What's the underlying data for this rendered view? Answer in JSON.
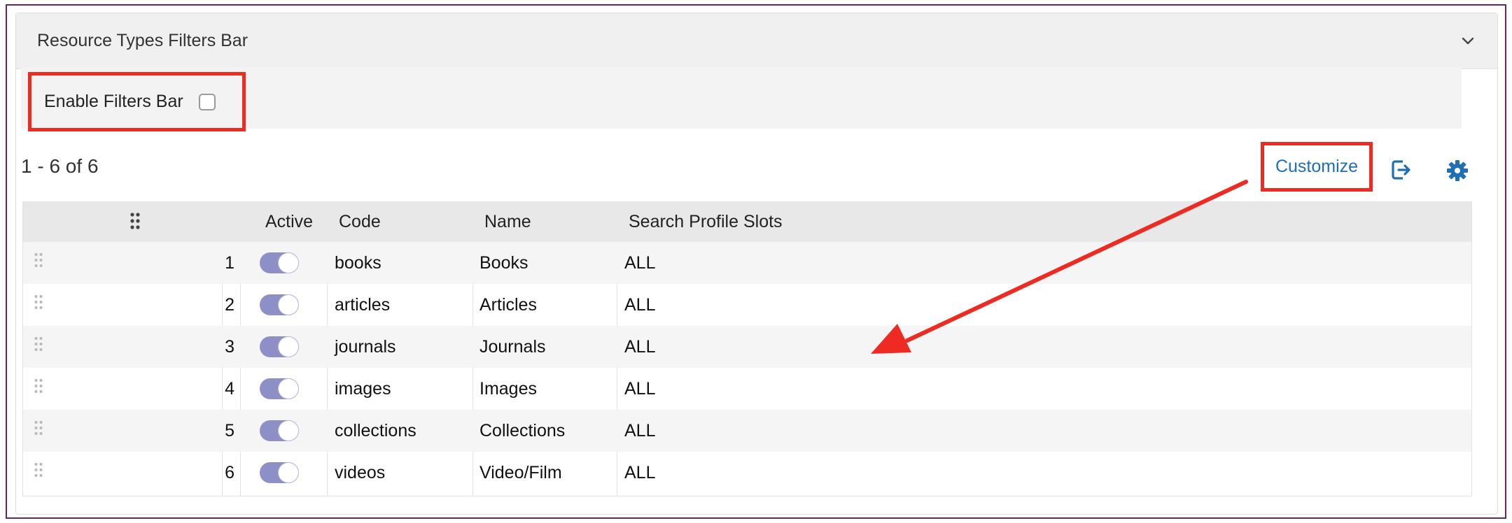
{
  "panel": {
    "title": "Resource Types Filters Bar"
  },
  "filters": {
    "enable_label": "Enable Filters Bar",
    "enabled": false
  },
  "list": {
    "count_label": "1 - 6 of 6"
  },
  "toolbar": {
    "customize_label": "Customize"
  },
  "table": {
    "columns": [
      "Active",
      "Code",
      "Name",
      "Search Profile Slots"
    ],
    "rows": [
      {
        "num": "1",
        "active": true,
        "code": "books",
        "name": "Books",
        "slots": "ALL"
      },
      {
        "num": "2",
        "active": true,
        "code": "articles",
        "name": "Articles",
        "slots": "ALL"
      },
      {
        "num": "3",
        "active": true,
        "code": "journals",
        "name": "Journals",
        "slots": "ALL"
      },
      {
        "num": "4",
        "active": true,
        "code": "images",
        "name": "Images",
        "slots": "ALL"
      },
      {
        "num": "5",
        "active": true,
        "code": "collections",
        "name": "Collections",
        "slots": "ALL"
      },
      {
        "num": "6",
        "active": true,
        "code": "videos",
        "name": "Video/Film",
        "slots": "ALL"
      }
    ]
  },
  "colors": {
    "highlight": "#ee2b22",
    "accent": "#1f6fb5",
    "toggle_on": "#8e8fc7",
    "frame": "#5b2a5e"
  },
  "icons": {
    "collapse": "chevron-down-icon",
    "export": "export-icon",
    "settings": "gear-icon",
    "drag": "drag-handle-icon"
  }
}
